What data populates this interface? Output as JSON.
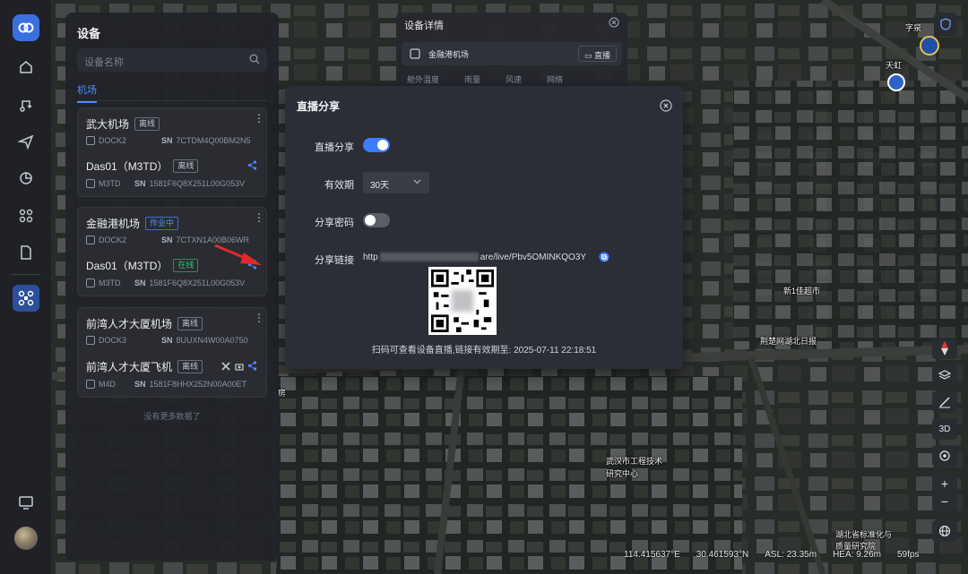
{
  "device_panel": {
    "title": "设备",
    "search_placeholder": "设备名称",
    "tab_label": "机场",
    "docks": [
      {
        "name": "武大机场",
        "status": "离线",
        "dock_model": "DOCK2",
        "dock_sn_label": "SN",
        "dock_sn": "7CTDM4Q00BM2N5",
        "drone_name": "Das01（M3TD）",
        "drone_status": "离线",
        "drone_model": "M3TD",
        "drone_sn_label": "SN",
        "drone_sn": "1581F6Q8X251L00G053V"
      },
      {
        "name": "金融港机场",
        "status": "作业中",
        "dock_model": "DOCK2",
        "dock_sn_label": "SN",
        "dock_sn": "7CTXN1A00B06WR",
        "drone_name": "Das01（M3TD）",
        "drone_status": "在线",
        "drone_model": "M3TD",
        "drone_sn_label": "SN",
        "drone_sn": "1581F6Q8X251L00G053V"
      },
      {
        "name": "前湾人才大厦机场",
        "status": "离线",
        "dock_model": "DOCK3",
        "dock_sn_label": "SN",
        "dock_sn": "8UUXN4W00A0750",
        "drone_name": "前湾人才大厦飞机",
        "drone_status": "离线",
        "drone_model": "M4D",
        "drone_sn_label": "SN",
        "drone_sn": "1581F8HHX252N00A00ET"
      }
    ],
    "no_more": "没有更多数据了"
  },
  "device_detail": {
    "title": "设备详情",
    "dock_name": "金融港机场",
    "live_button": "直播",
    "stats": [
      "舱外温度",
      "雨量",
      "风速",
      "网络"
    ]
  },
  "share_modal": {
    "title": "直播分享",
    "live_share_label": "直播分享",
    "live_share_on": true,
    "validity_label": "有效期",
    "validity_value": "30天",
    "password_label": "分享密码",
    "password_on": false,
    "link_label": "分享链接",
    "link_prefix": "http",
    "link_suffix": "are/live/Pbv5OMINKQO3Y",
    "qr_caption": "扫码可查看设备直播,链接有效期至: 2025-07-11 22:18:51"
  },
  "map": {
    "labels": [
      "字泉",
      "天虹",
      "新1佳超市",
      "荆楚网湖北日报",
      "武汉市工程技术",
      "研究中心",
      "湖北省标准化与",
      "质量研究院",
      "房"
    ],
    "controls": [
      "3D"
    ],
    "status": {
      "lon": "114.415637°E",
      "lat": "30.461593°N",
      "asl": "ASL: 23.35m",
      "hea": "HEA: 9.26m",
      "fps": "59fps"
    }
  },
  "colors": {
    "accent": "#3d7bff",
    "panel_bg": "#212329",
    "modal_bg": "#2b2e36",
    "online": "#3fbf74",
    "working": "#5a8ff0"
  }
}
